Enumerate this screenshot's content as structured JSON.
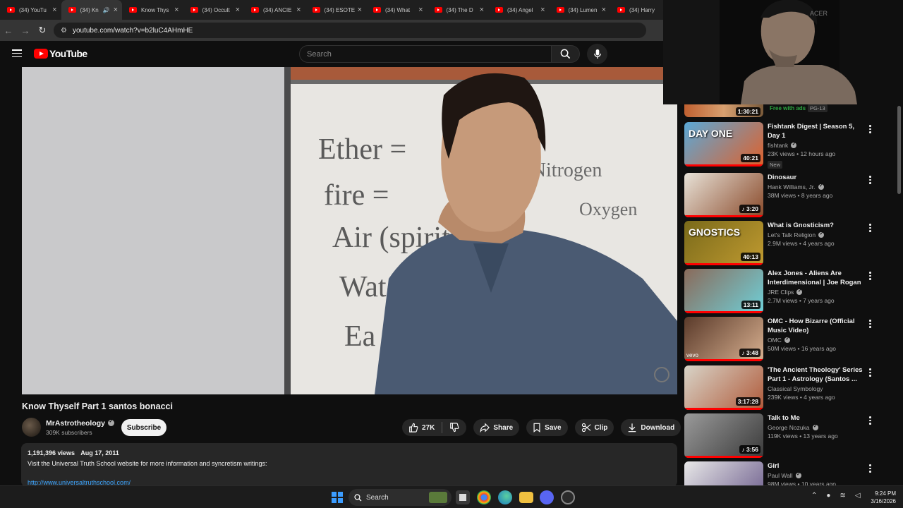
{
  "browser": {
    "tabs": [
      {
        "title": "(34) YouTu",
        "active": false
      },
      {
        "title": "(34) Kn",
        "active": true,
        "audio": true
      },
      {
        "title": "Know Thys",
        "active": false
      },
      {
        "title": "(34) Occult",
        "active": false
      },
      {
        "title": "(34) ANCIE",
        "active": false
      },
      {
        "title": "(34) ESOTE",
        "active": false
      },
      {
        "title": "(34) What",
        "active": false
      },
      {
        "title": "(34) The D",
        "active": false
      },
      {
        "title": "(34) Angel",
        "active": false
      },
      {
        "title": "(34) Lumen",
        "active": false
      },
      {
        "title": "(34) Harry",
        "active": false
      }
    ],
    "url": "youtube.com/watch?v=b2luC4AHmHE"
  },
  "youtube": {
    "logo_text": "YouTube",
    "search_placeholder": "Search"
  },
  "video": {
    "title": "Know Thyself Part 1 santos bonacci",
    "channel": "MrAstrotheology",
    "subscribers": "309K subscribers",
    "subscribe_label": "Subscribe",
    "likes": "27K",
    "share_label": "Share",
    "save_label": "Save",
    "clip_label": "Clip",
    "download_label": "Download",
    "views": "1,191,396 views",
    "date": "Aug 17, 2011",
    "description": "Visit the Universal Truth School website for more information and syncretism writings:",
    "link": "http://www.universaltruthschool.com/",
    "whiteboard": {
      "ether": "Ether =",
      "fire": "fire =",
      "air": "Air (spirit) =",
      "water": "Wate",
      "earth": "Ea",
      "nitrogen": "= Nitrogen",
      "oxygen": "Oxygen"
    }
  },
  "recommendations": {
    "top_partial": {
      "duration": "1:30:21",
      "badge": "Free with ads",
      "rating": "PG-13"
    },
    "items": [
      {
        "title": "Fishtank Digest | Season 5, Day 1",
        "channel": "fishtank",
        "verified": true,
        "meta": "23K views • 12 hours ago",
        "duration": "40:21",
        "badge": "New",
        "thumb_text": "DAY ONE",
        "colors": [
          "#5aa9d8",
          "#e0602a"
        ]
      },
      {
        "title": "Dinosaur",
        "channel": "Hank Williams, Jr.",
        "verified": true,
        "meta": "38M views • 8 years ago",
        "duration": "3:20",
        "music": true,
        "colors": [
          "#e8e2d8",
          "#8a4a2a"
        ]
      },
      {
        "title": "What is Gnosticism?",
        "channel": "Let's Talk Religion",
        "verified": true,
        "meta": "2.9M views • 4 years ago",
        "duration": "40:13",
        "thumb_text": "GNOSTICS",
        "colors": [
          "#7a6a1a",
          "#c09a30"
        ]
      },
      {
        "title": "Alex Jones - Aliens Are Interdimensional | Joe Rogan",
        "channel": "JRE Clips",
        "verified": true,
        "meta": "2.7M views • 7 years ago",
        "duration": "13:11",
        "colors": [
          "#8a6a5a",
          "#6fd0d8"
        ]
      },
      {
        "title": "OMC - How Bizarre (Official Music Video)",
        "channel": "OMC",
        "verified": true,
        "meta": "50M views • 16 years ago",
        "duration": "3:48",
        "music": true,
        "corner_text": "vevo",
        "colors": [
          "#5a3a2a",
          "#d8b090"
        ]
      },
      {
        "title": "'The Ancient Theology' Series Part 1 - Astrology (Santos ...",
        "channel": "Classical Symbology",
        "verified": false,
        "meta": "239K views • 4 years ago",
        "duration": "3:17:28",
        "colors": [
          "#d8d4c8",
          "#b05a3a"
        ]
      },
      {
        "title": "Talk to Me",
        "channel": "George Nozuka",
        "verified": true,
        "meta": "119K views • 13 years ago",
        "duration": "3:56",
        "music": true,
        "colors": [
          "#9a9a9a",
          "#3a3a3a"
        ]
      },
      {
        "title": "Girl",
        "channel": "Paul Wall",
        "verified": true,
        "meta": "98M views • 10 years ago",
        "duration": "",
        "colors": [
          "#e8e8e8",
          "#6a5a8a"
        ]
      }
    ]
  },
  "webcam": {
    "label": "ACER"
  },
  "taskbar": {
    "search_label": "Search",
    "time": "9:24 PM",
    "date": "3/16/2026"
  }
}
